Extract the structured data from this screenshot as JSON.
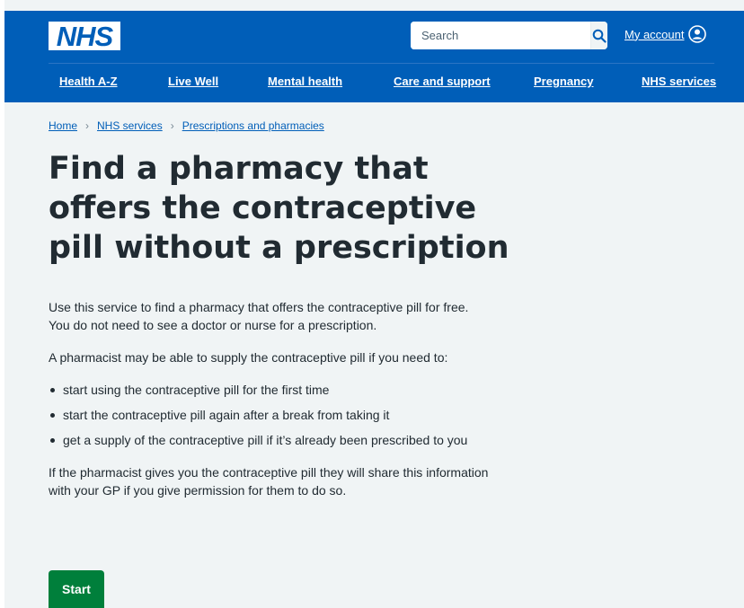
{
  "header": {
    "logo_text": "NHS",
    "search": {
      "placeholder": "Search",
      "button_icon": "search-icon"
    },
    "account_label": "My account",
    "account_icon": "user-circle-icon",
    "brand_color": "#005eb8"
  },
  "nav": {
    "items": [
      {
        "label": "Health A-Z"
      },
      {
        "label": "Live Well"
      },
      {
        "label": "Mental health"
      },
      {
        "label": "Care and support"
      },
      {
        "label": "Pregnancy"
      },
      {
        "label": "NHS services"
      }
    ]
  },
  "breadcrumb": {
    "items": [
      {
        "label": "Home"
      },
      {
        "label": "NHS services"
      },
      {
        "label": "Prescriptions and pharmacies"
      }
    ]
  },
  "page": {
    "title": "Find a pharmacy that offers the contraceptive pill without a prescription",
    "intro": "Use this service to find a pharmacy that offers the contraceptive pill for free. You do not need to see a doctor or nurse for a prescription.",
    "lead": "A pharmacist may be able to supply the contraceptive pill if you need to:",
    "bullets": [
      "start using the contraceptive pill for the first time",
      "start the contraceptive pill again after a break from taking it",
      "get a supply of the contraceptive pill if it’s already been prescribed to you"
    ],
    "closing": "If the pharmacist gives you the contraceptive pill they will share this information with your GP if you give permission for them to do so.",
    "start_label": "Start",
    "start_color": "#007f3b"
  }
}
